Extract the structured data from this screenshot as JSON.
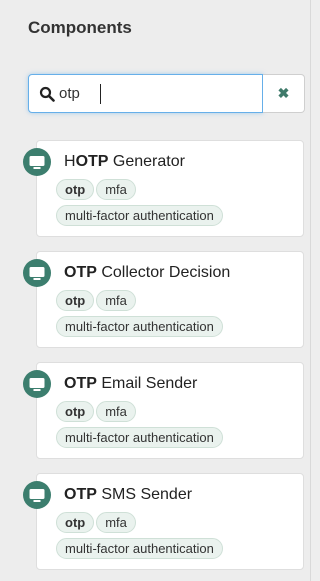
{
  "panel": {
    "title": "Components"
  },
  "search": {
    "value": "otp"
  },
  "cards": [
    {
      "name_pre": "H",
      "name_match": "OTP",
      "name_post": " Generator",
      "tags": [
        "otp",
        "mfa"
      ],
      "tag_long": "multi-factor authentication"
    },
    {
      "name_pre": "",
      "name_match": "OTP",
      "name_post": " Collector Decision",
      "tags": [
        "otp",
        "mfa"
      ],
      "tag_long": "multi-factor authentication"
    },
    {
      "name_pre": "",
      "name_match": "OTP",
      "name_post": " Email Sender",
      "tags": [
        "otp",
        "mfa"
      ],
      "tag_long": "multi-factor authentication"
    },
    {
      "name_pre": "",
      "name_match": "OTP",
      "name_post": " SMS Sender",
      "tags": [
        "otp",
        "mfa"
      ],
      "tag_long": "multi-factor authentication"
    }
  ],
  "colors": {
    "accent": "#3c7e6e",
    "tag_bg": "#eaf2ee",
    "focus": "#66afe9"
  },
  "icons": {
    "search": "search-icon",
    "clear": "close-icon",
    "component": "monitor-icon"
  }
}
